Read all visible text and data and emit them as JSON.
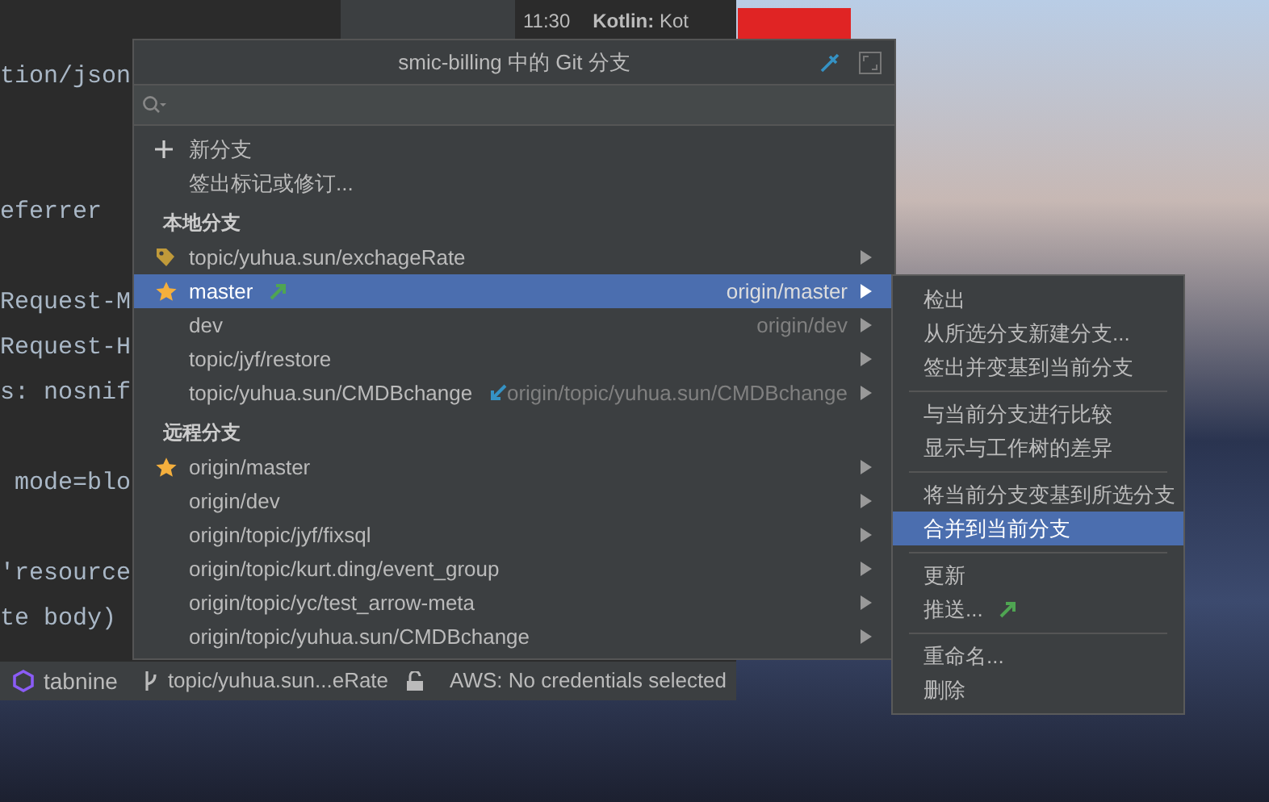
{
  "editor": {
    "code_lines": [
      "tion/json",
      "eferrer",
      "Request-M",
      "Request-H",
      "s: nosnif",
      " mode=blo",
      "'resource",
      "te body)"
    ]
  },
  "event_log": {
    "time": "11:30",
    "source": "Kotlin:",
    "message": "Kot"
  },
  "popup": {
    "title": "smic-billing 中的 Git 分支",
    "actions": [
      {
        "kind": "new",
        "label": "新分支"
      },
      {
        "kind": "plain",
        "label": "签出标记或修订..."
      }
    ],
    "sections": [
      {
        "title": "本地分支",
        "branches": [
          {
            "name": "topic/yuhua.sun/exchageRate",
            "current": true,
            "favorite": false,
            "outgoing": false,
            "incoming": false,
            "selected": false
          },
          {
            "name": "master",
            "current": false,
            "favorite": true,
            "outgoing": true,
            "incoming": false,
            "tracking": "origin/master",
            "selected": true
          },
          {
            "name": "dev",
            "current": false,
            "favorite": false,
            "outgoing": false,
            "incoming": false,
            "tracking": "origin/dev",
            "selected": false
          },
          {
            "name": "topic/jyf/restore",
            "current": false,
            "favorite": false,
            "outgoing": false,
            "incoming": false,
            "selected": false
          },
          {
            "name": "topic/yuhua.sun/CMDBchange",
            "current": false,
            "favorite": false,
            "outgoing": false,
            "incoming": true,
            "tracking": "origin/topic/yuhua.sun/CMDBchange",
            "selected": false
          }
        ]
      },
      {
        "title": "远程分支",
        "branches": [
          {
            "name": "origin/master",
            "current": false,
            "favorite": true,
            "outgoing": false,
            "incoming": false,
            "selected": false
          },
          {
            "name": "origin/dev",
            "current": false,
            "favorite": false,
            "outgoing": false,
            "incoming": false,
            "selected": false
          },
          {
            "name": "origin/topic/jyf/fixsql",
            "current": false,
            "favorite": false,
            "outgoing": false,
            "incoming": false,
            "selected": false
          },
          {
            "name": "origin/topic/kurt.ding/event_group",
            "current": false,
            "favorite": false,
            "outgoing": false,
            "incoming": false,
            "selected": false
          },
          {
            "name": "origin/topic/yc/test_arrow-meta",
            "current": false,
            "favorite": false,
            "outgoing": false,
            "incoming": false,
            "selected": false
          },
          {
            "name": "origin/topic/yuhua.sun/CMDBchange",
            "current": false,
            "favorite": false,
            "outgoing": false,
            "incoming": false,
            "selected": false
          }
        ]
      }
    ]
  },
  "submenu": {
    "groups": [
      [
        {
          "label": "检出",
          "outgoing": false,
          "selected": false
        },
        {
          "label": "从所选分支新建分支...",
          "outgoing": false,
          "selected": false
        },
        {
          "label": "签出并变基到当前分支",
          "outgoing": false,
          "selected": false
        }
      ],
      [
        {
          "label": "与当前分支进行比较",
          "outgoing": false,
          "selected": false
        },
        {
          "label": "显示与工作树的差异",
          "outgoing": false,
          "selected": false
        }
      ],
      [
        {
          "label": "将当前分支变基到所选分支",
          "outgoing": false,
          "selected": false
        },
        {
          "label": "合并到当前分支",
          "outgoing": false,
          "selected": true
        }
      ],
      [
        {
          "label": "更新",
          "outgoing": false,
          "selected": false
        },
        {
          "label": "推送...",
          "outgoing": true,
          "selected": false
        }
      ],
      [
        {
          "label": "重命名...",
          "outgoing": false,
          "selected": false
        },
        {
          "label": "删除",
          "outgoing": false,
          "selected": false
        }
      ]
    ]
  },
  "status_bar": {
    "plugin": "tabnine",
    "branch": "topic/yuhua.sun...eRate",
    "aws": "AWS: No credentials selected"
  }
}
